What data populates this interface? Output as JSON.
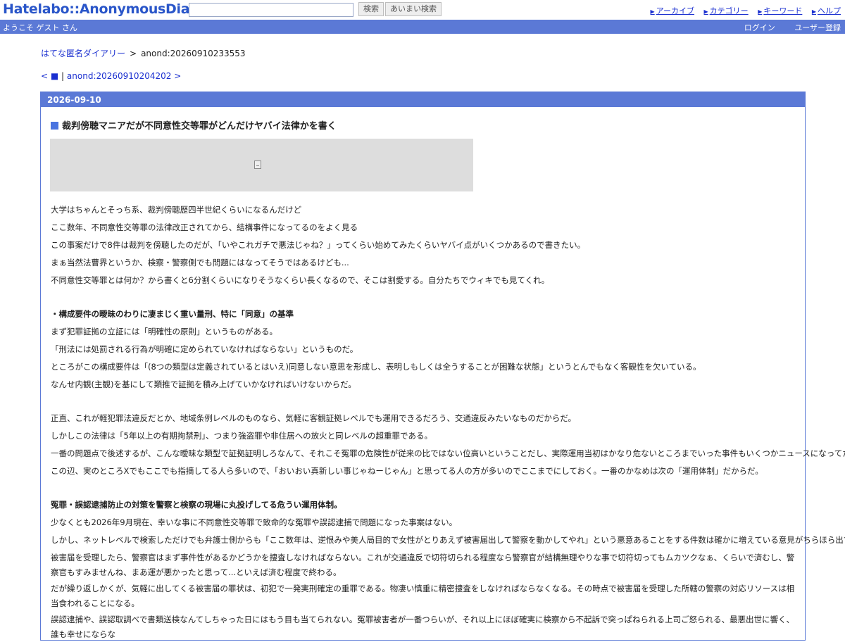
{
  "header": {
    "logo": "Hatelabo::AnonymousDiary",
    "search_placeholder": "",
    "search_button": "検索",
    "fuzzy_button": "あいまい検索",
    "nav": [
      "アーカイブ",
      "カテゴリー",
      "キーワード",
      "ヘルプ"
    ]
  },
  "userbar": {
    "welcome": "ようこそ ゲスト さん",
    "login": "ログイン",
    "register": "ユーザー登録"
  },
  "breadcrumb": {
    "home": "はてな匿名ダイアリー",
    "separator": ">",
    "current": "anond:20260910233553"
  },
  "pager": {
    "prev": "< ■",
    "divider": "|",
    "next": "anond:20260910204202 >"
  },
  "entry": {
    "date": "2026-09-10",
    "title": "裁判傍聴マニアだが不同意性交等罪がどんだけヤバイ法律かを書く",
    "paragraphs": [
      {
        "text": "大学はちゃんとそっち系、裁判傍聴歴四半世紀くらいになるんだけど"
      },
      {
        "text": "ここ数年、不同意性交等罪の法律改正されてから、結構事件になってるのをよく見る"
      },
      {
        "text": "この事案だけで8件は裁判を傍聴したのだが、「いやこれガチで悪法じゃね？」ってくらい始めてみたくらいヤバイ点がいくつかあるので書きたい。"
      },
      {
        "text": "まぁ当然法曹界というか、検察・警察側でも問題にはなってそうではあるけども..."
      },
      {
        "text": "不同意性交等罪とは何か？から書くと6分割くらいになりそうなくらい長くなるので、そこは割愛する。自分たちでウィキでも見てくれ。"
      },
      {
        "text": "",
        "gap": true
      },
      {
        "text": "・構成要件の曖昧のわりに凄まじく重い量刑、特に「同意」の基準",
        "heading": true
      },
      {
        "text": "まず犯罪証拠の立証には「明確性の原則」というものがある。"
      },
      {
        "text": "「刑法には処罰される行為が明確に定められていなければならない」というものだ。"
      },
      {
        "text": "ところがこの構成要件は「(8つの類型は定義されているとはいえ)同意しない意思を形成し、表明しもしくは全うすることが困難な状態」というとんでもなく客観性を欠いている。"
      },
      {
        "text": "なんせ内観(主観)を基にして類推で証拠を積み上げていかなければいけないからだ。"
      },
      {
        "text": "",
        "gap": true
      },
      {
        "text": "正直、これが軽犯罪法違反だとか、地域条例レベルのものなら、気軽に客観証拠レベルでも運用できるだろう、交通違反みたいなものだからだ。"
      },
      {
        "text": "しかしこの法律は「5年以上の有期拘禁刑」、つまり強盗罪や非住居への放火と同レベルの超重罪である。"
      },
      {
        "text": "一番の問題点で後述するが、こんな曖昧な類型で証拠証明しろなんて、それこそ冤罪の危険性が従来の比ではない位高いということだし、実際運用当初はかなり危ないところまでいった事件もいくつかニュースになってたりする。"
      },
      {
        "text": "この辺、実のところXでもここでも指摘してる人ら多いので、「おいおい真新しい事じゃねーじゃん」と思ってる人の方が多いのでここまでにしておく。一番のかなめは次の「運用体制」だからだ。"
      },
      {
        "text": "",
        "gap": true
      },
      {
        "text": "冤罪・誤認逮捕防止の対策を警察と検察の現場に丸投げしてる危うい運用体制。",
        "heading": true
      },
      {
        "text": "少なくとも2026年9月現在、幸いな事に不同意性交等罪で致命的な冤罪や誤認逮捕で問題になった事案はない。"
      },
      {
        "text": "しかし、ネットレベルで検索しただけでも弁護士側からも「ここ数年は、逆恨みや美人局目的で女性がとりあえず被害届出して警察を動かしてやれ」という悪意あることをする件数は確かに増えている意見がちらほら出ている。"
      },
      {
        "text": "被害届を受理したら、警察官はまず事件性があるかどうかを捜査しなければならない。これが交通違反で切符切られる程度なら警察官が結構無理やりな事で切符切ってもムカツクなぁ、くらいで済むし、警察官もすみませんね、まあ運が悪かったと思って...といえば済む程度で終わる。",
        "wrap": true
      },
      {
        "text": "だが繰り返しかくが、気軽に出してくる被害届の罪状は、初犯で一発実刑確定の重罪である。物凄い慎重に精密捜査をしなければならなくなる。その時点で被害届を受理した所轄の警察の対応リソースは相当食われることになる。",
        "wrap": true
      },
      {
        "text": "誤認逮捕や、誤認取調べで書類送検なんてしちゃった日にはもう目も当てられない。冤罪被害者が一番つらいが、それ以上にほぼ確実に検察から不起訴で突っぱねられる上司ご怒られる、最悪出世に響く、誰も幸せにならな",
        "wrap": true
      }
    ]
  }
}
